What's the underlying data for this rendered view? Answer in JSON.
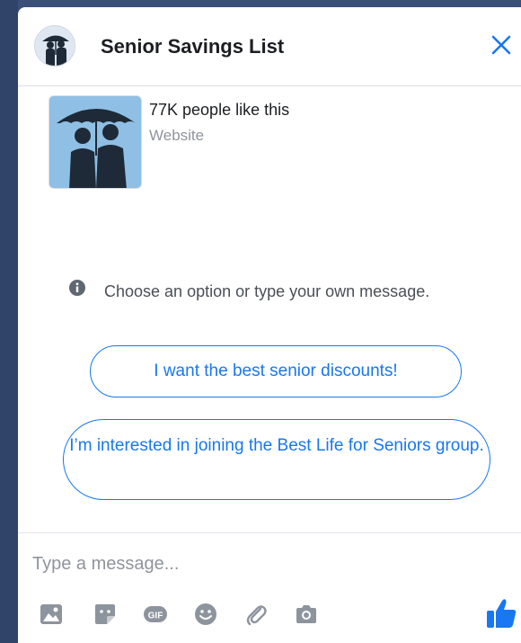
{
  "header": {
    "title": "Senior Savings List"
  },
  "page_info": {
    "likes": "77K people like this",
    "type": "Website"
  },
  "prompt": {
    "hint": "Choose an option or type your own message."
  },
  "quick_replies": [
    {
      "label": "I want the best senior discounts!"
    },
    {
      "label": "I’m interested in joining the Best Life for Seniors group."
    }
  ],
  "composer": {
    "placeholder": "Type a message..."
  },
  "colors": {
    "accent": "#1877f2",
    "tool_icon": "#8d949e",
    "avatar_bg": "#8fbfe4"
  },
  "icons": {
    "close": "close-icon",
    "info": "info-icon",
    "tools": [
      "image-icon",
      "sticker-icon",
      "gif-icon",
      "emoji-icon",
      "attachment-icon",
      "camera-icon"
    ],
    "send": "thumbs-up-icon"
  }
}
